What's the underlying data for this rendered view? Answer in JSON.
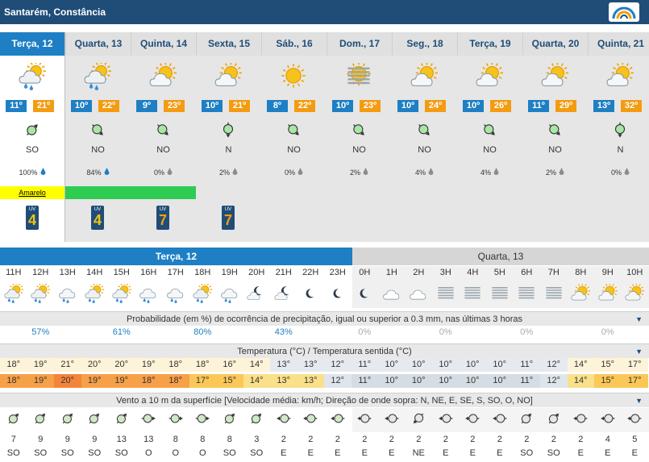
{
  "header": {
    "title": "Santarém, Constância"
  },
  "days": [
    {
      "label": "Terça, 12",
      "icon": "cloud-sun-rain-icon",
      "tmin": "11º",
      "tmax": "21º",
      "wind_dir": "SO",
      "precip": "100%",
      "drop": "blue",
      "alert": "Amarelo",
      "alert_level": "yellow",
      "uv": "4"
    },
    {
      "label": "Quarta, 13",
      "icon": "cloud-sun-rain-icon",
      "tmin": "10º",
      "tmax": "22º",
      "wind_dir": "NO",
      "precip": "84%",
      "drop": "blue",
      "alert": "",
      "alert_level": "green",
      "uv": "4"
    },
    {
      "label": "Quinta, 14",
      "icon": "sun-cloud-icon",
      "tmin": "9º",
      "tmax": "23º",
      "wind_dir": "NO",
      "precip": "0%",
      "drop": "grey",
      "alert": "",
      "alert_level": "green",
      "uv": "7"
    },
    {
      "label": "Sexta, 15",
      "icon": "sun-cloud-icon",
      "tmin": "10º",
      "tmax": "21º",
      "wind_dir": "N",
      "precip": "2%",
      "drop": "grey",
      "alert": "",
      "alert_level": "none",
      "uv": "7"
    },
    {
      "label": "Sáb., 16",
      "icon": "sun-icon",
      "tmin": "8º",
      "tmax": "22º",
      "wind_dir": "NO",
      "precip": "0%",
      "drop": "grey",
      "alert": "",
      "alert_level": "none",
      "uv": ""
    },
    {
      "label": "Dom., 17",
      "icon": "sun-fog-icon",
      "tmin": "10º",
      "tmax": "23º",
      "wind_dir": "NO",
      "precip": "2%",
      "drop": "grey",
      "alert": "",
      "alert_level": "none",
      "uv": ""
    },
    {
      "label": "Seg., 18",
      "icon": "sun-cloud-icon",
      "tmin": "10º",
      "tmax": "24º",
      "wind_dir": "NO",
      "precip": "4%",
      "drop": "grey",
      "alert": "",
      "alert_level": "none",
      "uv": ""
    },
    {
      "label": "Terça, 19",
      "icon": "sun-cloud-icon",
      "tmin": "10º",
      "tmax": "26º",
      "wind_dir": "NO",
      "precip": "4%",
      "drop": "grey",
      "alert": "",
      "alert_level": "none",
      "uv": ""
    },
    {
      "label": "Quarta, 20",
      "icon": "sun-cloud-icon",
      "tmin": "11º",
      "tmax": "29º",
      "wind_dir": "NO",
      "precip": "2%",
      "drop": "grey",
      "alert": "",
      "alert_level": "none",
      "uv": ""
    },
    {
      "label": "Quinta, 21",
      "icon": "sun-cloud-icon",
      "tmin": "13º",
      "tmax": "32º",
      "wind_dir": "N",
      "precip": "0%",
      "drop": "grey",
      "alert": "",
      "alert_level": "none",
      "uv": ""
    }
  ],
  "uv_label": "UV",
  "hourly": {
    "today_label": "Terça, 12",
    "tomorrow_label": "Quarta, 13",
    "hours": [
      "11H",
      "12H",
      "13H",
      "14H",
      "15H",
      "16H",
      "17H",
      "18H",
      "19H",
      "20H",
      "21H",
      "22H",
      "23H",
      "0H",
      "1H",
      "2H",
      "3H",
      "4H",
      "5H",
      "6H",
      "7H",
      "8H",
      "9H",
      "10H"
    ],
    "icons": [
      "sun-cloud-rain",
      "sun-cloud-rain",
      "cloud-rain",
      "sun-cloud-rain",
      "sun-cloud-rain",
      "cloud-rain",
      "cloud-rain",
      "sun-cloud-rain",
      "cloud-rain",
      "moon-cloud",
      "moon-cloud",
      "moon",
      "moon",
      "moon",
      "cloud",
      "cloud",
      "fog",
      "fog",
      "fog",
      "fog",
      "fog",
      "sun-cloud",
      "sun-cloud",
      "sun-cloud"
    ],
    "precip_header": "Probabilidade (em %) de ocorrência de precipitação, igual ou superior a 0.3 mm, nas últimas 3 horas",
    "precip": [
      "57%",
      "61%",
      "80%",
      "43%",
      "0%",
      "0%",
      "0%",
      "0%"
    ],
    "temp_header": "Temperatura (°C) / Temperatura sentida (°C)",
    "temp": [
      "18°",
      "19°",
      "21°",
      "20°",
      "20°",
      "19°",
      "18°",
      "18°",
      "16°",
      "14°",
      "13°",
      "13°",
      "12°",
      "11°",
      "10°",
      "10°",
      "10°",
      "10°",
      "10°",
      "11°",
      "12°",
      "14°",
      "15°",
      "17°"
    ],
    "feel": [
      "18°",
      "19°",
      "20°",
      "19°",
      "19°",
      "18°",
      "18°",
      "17°",
      "15°",
      "14°",
      "13°",
      "13°",
      "12°",
      "11°",
      "10°",
      "10°",
      "10°",
      "10°",
      "10°",
      "11°",
      "12°",
      "14°",
      "15°",
      "17°"
    ],
    "wind_header": "Vento a 10 m da superfície [Velocidade média: km/h; Direção de onde sopra: N, NE, E, SE, S, SO, O, NO]",
    "wind_speed": [
      "7",
      "9",
      "9",
      "9",
      "13",
      "13",
      "8",
      "8",
      "8",
      "3",
      "2",
      "2",
      "2",
      "2",
      "2",
      "2",
      "2",
      "2",
      "2",
      "2",
      "2",
      "2",
      "4",
      "5"
    ],
    "wind_dir": [
      "SO",
      "SO",
      "SO",
      "SO",
      "SO",
      "O",
      "O",
      "O",
      "SO",
      "SO",
      "E",
      "E",
      "E",
      "E",
      "E",
      "NE",
      "E",
      "E",
      "E",
      "SO",
      "SO",
      "E",
      "E",
      "E"
    ]
  },
  "colors": {
    "header": "#1f4d78",
    "accent": "#1e7fc4",
    "tmax": "#f39c12"
  }
}
